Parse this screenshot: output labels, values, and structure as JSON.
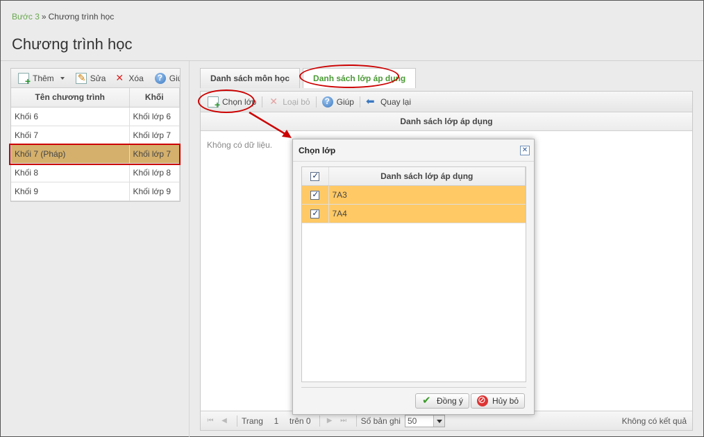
{
  "breadcrumb": {
    "step": "Bước 3",
    "separator": "»",
    "current": "Chương trình học"
  },
  "page_title": "Chương trình học",
  "left_toolbar": {
    "add": "Thêm",
    "edit": "Sửa",
    "delete": "Xóa",
    "help": "Giúp"
  },
  "program_table": {
    "headers": [
      "Tên chương trình",
      "Khối"
    ],
    "rows": [
      {
        "name": "Khối 6",
        "grade": "Khối lớp 6"
      },
      {
        "name": "Khối 7",
        "grade": "Khối lớp 7"
      },
      {
        "name": "Khối 7 (Pháp)",
        "grade": "Khối lớp 7"
      },
      {
        "name": "Khối 8",
        "grade": "Khối lớp 8"
      },
      {
        "name": "Khối 9",
        "grade": "Khối lớp 9"
      }
    ],
    "selected_index": 2
  },
  "tabs": [
    {
      "label": "Danh sách môn học",
      "active": false
    },
    {
      "label": "Danh sách lớp áp dụng",
      "active": true
    }
  ],
  "right_toolbar": {
    "choose_class": "Chọn lớp",
    "remove": "Loại bỏ",
    "help": "Giúp",
    "back": "Quay lại"
  },
  "class_list": {
    "header": "Danh sách lớp áp dụng",
    "empty_message": "Không có dữ liệu."
  },
  "pager": {
    "page_label": "Trang",
    "page_value": "1",
    "of_label": "trên 0",
    "records_label": "Số bản ghi",
    "records_value": "50",
    "no_result": "Không có kết quả"
  },
  "modal": {
    "title": "Chọn lớp",
    "header": "Danh sách lớp áp dụng",
    "rows": [
      {
        "label": "7A3",
        "checked": true
      },
      {
        "label": "7A4",
        "checked": true
      }
    ],
    "ok_label": "Đồng ý",
    "cancel_label": "Hủy bỏ"
  },
  "colors": {
    "accent_green": "#4b9a35",
    "selected_row": "#d4b06c",
    "highlight_row": "#ffc966",
    "annotation_red": "#cc0000"
  }
}
